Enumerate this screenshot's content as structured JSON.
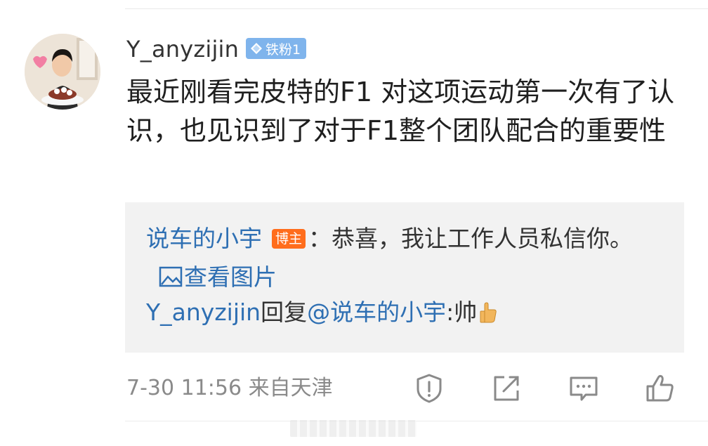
{
  "comment": {
    "username": "Y_anyzijin",
    "fan_badge": "铁粉1",
    "text": "最近刚看完皮特的F1 对这项运动第一次有了认识，也见识到了对于F1整个团队配合的重要性",
    "avatar_icon": "user-avatar-photo",
    "meta": "7-30 11:56 来自天津"
  },
  "reply_box": {
    "first_reply": {
      "author": "说车的小宇",
      "badge": "博主",
      "text": "：恭喜，我让工作人员私信你。",
      "view_pic_label": "查看图片",
      "view_pic_icon": "image-icon"
    },
    "second_reply": {
      "author": "Y_anyzijin",
      "reply_word": "回复",
      "mention": "@说车的小宇",
      "text": ":帅",
      "emoji": "thumbs-up-emoji"
    }
  },
  "actions": [
    {
      "name": "report",
      "icon": "warning-shield-icon"
    },
    {
      "name": "share",
      "icon": "share-external-icon"
    },
    {
      "name": "comment",
      "icon": "comment-bubble-icon"
    },
    {
      "name": "like",
      "icon": "thumbs-up-icon"
    }
  ],
  "colors": {
    "link_blue": "#2e6fb3",
    "badge_blue": "#7fb4ec",
    "badge_orange": "#ff6d1c",
    "reply_bg": "#f2f2f2",
    "meta_gray": "#8a8a8a"
  }
}
